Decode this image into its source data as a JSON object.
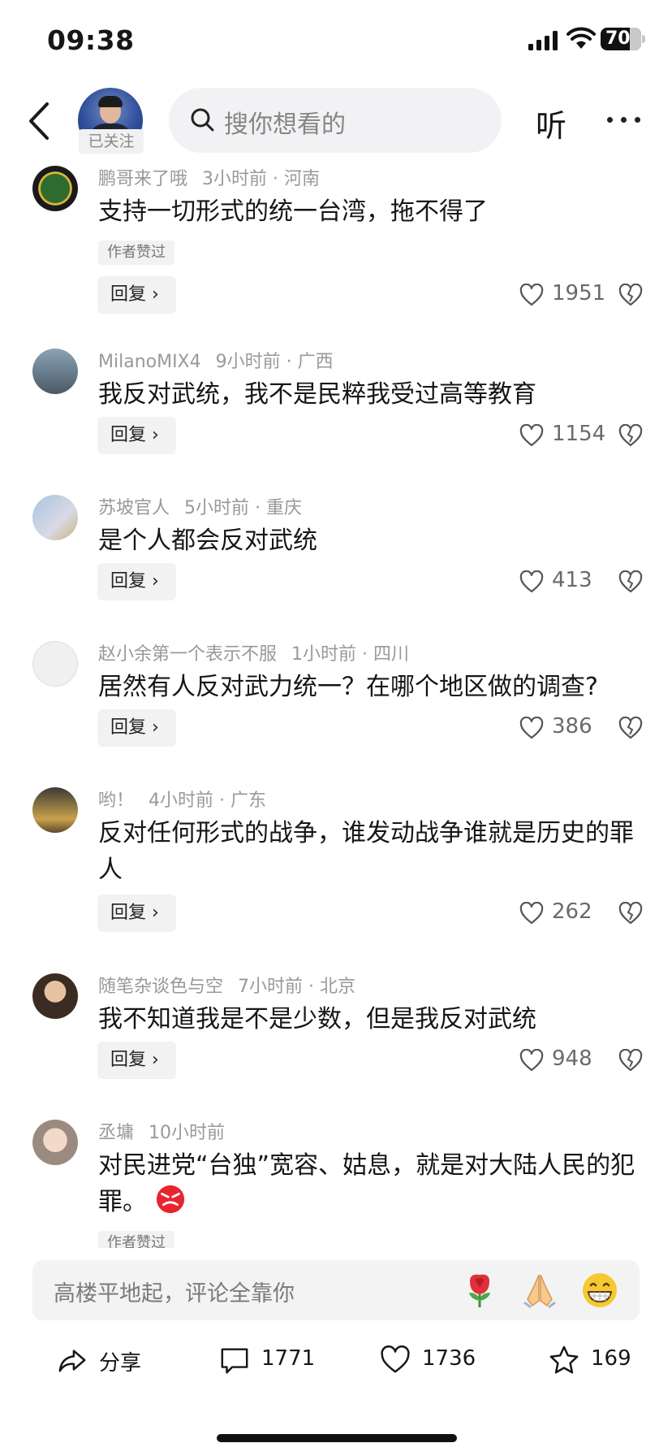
{
  "status_bar": {
    "time": "09:38",
    "battery": "70"
  },
  "header": {
    "followed_badge": "已关注",
    "search_placeholder": "搜你想看的",
    "listen_label": "听"
  },
  "comments": [
    {
      "user": "鹏哥来了哦",
      "time": "3小时前",
      "location": "· 河南",
      "text": "支持一切形式的统一台湾，拖不得了",
      "author_liked": "作者赞过",
      "reply": "回复",
      "likes": "1951"
    },
    {
      "user": "MilanoMIX4",
      "time": "9小时前",
      "location": "· 广西",
      "text": "我反对武统，我不是民粹我受过高等教育",
      "reply": "回复",
      "likes": "1154"
    },
    {
      "user": "苏坡官人",
      "time": "5小时前",
      "location": "· 重庆",
      "text": "是个人都会反对武统",
      "reply": "回复",
      "likes": "413"
    },
    {
      "user": "赵小余第一个表示不服",
      "time": "1小时前",
      "location": "· 四川",
      "text": "居然有人反对武力统一？在哪个地区做的调查?",
      "reply": "回复",
      "likes": "386"
    },
    {
      "user": "哟！",
      "time": "4小时前",
      "location": "· 广东",
      "text": "反对任何形式的战争，谁发动战争谁就是历史的罪人",
      "reply": "回复",
      "likes": "262"
    },
    {
      "user": "随笔杂谈色与空",
      "time": "7小时前",
      "location": "· 北京",
      "text": "我不知道我是不是少数，但是我反对武统",
      "reply": "回复",
      "likes": "948"
    },
    {
      "user": "丞墉",
      "time": "10小时前",
      "location": "",
      "text": "对民进党“台独”宽容、姑息，就是对大陆人民的犯罪。",
      "author_liked": "作者赞过"
    }
  ],
  "input_bar": {
    "placeholder": "高楼平地起，评论全靠你",
    "emojis": [
      "rose-icon",
      "folded-hands-icon",
      "grin-icon"
    ]
  },
  "actions": {
    "share_label": "分享",
    "comments_count": "1771",
    "likes_count": "1736",
    "favorites_count": "169"
  },
  "colors": {
    "text": "#161616",
    "meta": "#999999",
    "chip_bg": "#f2f2f2",
    "input_bg": "#f3f3f3"
  }
}
